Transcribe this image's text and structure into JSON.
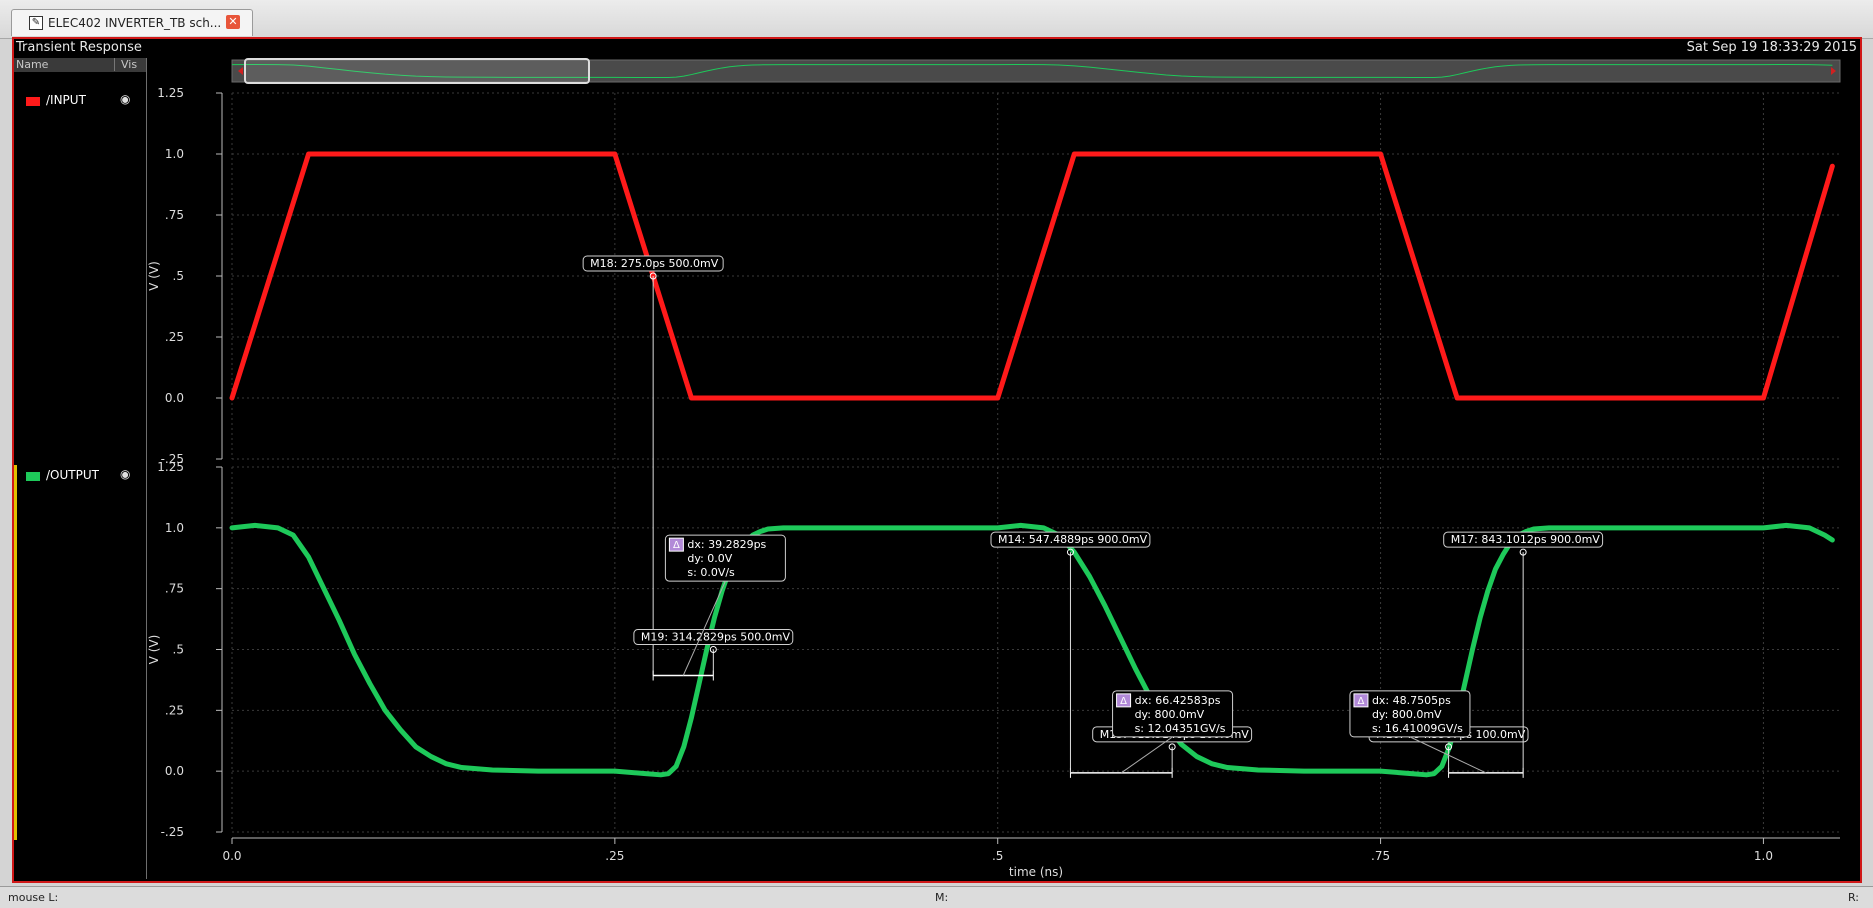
{
  "tab": {
    "title": "ELEC402 INVERTER_TB sch..."
  },
  "window": {
    "title": "Transient Response",
    "timestamp": "Sat Sep 19 18:33:29 2015"
  },
  "panel": {
    "name_header": "Name",
    "vis_header": "Vis"
  },
  "signals": [
    {
      "name": "/INPUT",
      "color": "#ff1a1a"
    },
    {
      "name": "/OUTPUT",
      "color": "#1ec95a"
    }
  ],
  "status": {
    "left": "mouse L:",
    "middle": "M:",
    "right": "R:"
  },
  "chart_data": {
    "type": "line",
    "xlabel": "time (ns)",
    "xlim": [
      0,
      1.05
    ],
    "x_ticks": [
      "0.0",
      ".25",
      ".5",
      ".75",
      "1.0"
    ],
    "x_tick_values": [
      0,
      0.25,
      0.5,
      0.75,
      1.0
    ],
    "panels": [
      {
        "signal": "/INPUT",
        "ylabel": "V (V)",
        "ylim": [
          -0.25,
          1.25
        ],
        "y_ticks": [
          "1.25",
          "1.0",
          ".75",
          ".5",
          ".25",
          "0.0",
          "-.25"
        ],
        "y_tick_values": [
          1.25,
          1.0,
          0.75,
          0.5,
          0.25,
          0.0,
          -0.25
        ],
        "series": [
          {
            "name": "/INPUT",
            "color": "#ff1a1a",
            "x": [
              0,
              0.05,
              0.25,
              0.3,
              0.5,
              0.55,
              0.75,
              0.8,
              1.0,
              1.045
            ],
            "y": [
              0,
              1.0,
              1.0,
              0.0,
              0.0,
              1.0,
              1.0,
              0.0,
              0.0,
              0.95
            ]
          }
        ],
        "markers": [
          {
            "label": "M18: 275.0ps 500.0mV",
            "x": 0.275,
            "y": 0.5
          }
        ]
      },
      {
        "signal": "/OUTPUT",
        "ylabel": "V (V)",
        "ylim": [
          -0.25,
          1.25
        ],
        "y_ticks": [
          "1.25",
          "1.0",
          ".75",
          ".5",
          ".25",
          "0.0",
          "-.25"
        ],
        "y_tick_values": [
          1.25,
          1.0,
          0.75,
          0.5,
          0.25,
          0.0,
          -0.25
        ],
        "series": [
          {
            "name": "/OUTPUT",
            "color": "#1ec95a",
            "x": [
              0,
              0.015,
              0.03,
              0.04,
              0.05,
              0.06,
              0.07,
              0.08,
              0.09,
              0.1,
              0.11,
              0.12,
              0.13,
              0.14,
              0.15,
              0.17,
              0.2,
              0.25,
              0.27,
              0.28,
              0.285,
              0.29,
              0.295,
              0.3,
              0.305,
              0.31,
              0.315,
              0.32,
              0.325,
              0.33,
              0.335,
              0.34,
              0.345,
              0.35,
              0.36,
              0.38,
              0.4,
              0.5,
              0.515,
              0.53,
              0.54,
              0.55,
              0.56,
              0.57,
              0.58,
              0.59,
              0.6,
              0.61,
              0.62,
              0.63,
              0.64,
              0.65,
              0.67,
              0.7,
              0.75,
              0.77,
              0.78,
              0.785,
              0.79,
              0.795,
              0.8,
              0.805,
              0.81,
              0.815,
              0.82,
              0.825,
              0.83,
              0.835,
              0.84,
              0.845,
              0.85,
              0.86,
              0.88,
              0.9,
              1.0,
              1.015,
              1.03,
              1.04,
              1.045
            ],
            "y": [
              1.0,
              1.01,
              1.0,
              0.97,
              0.88,
              0.75,
              0.62,
              0.48,
              0.36,
              0.25,
              0.17,
              0.1,
              0.06,
              0.03,
              0.015,
              0.005,
              0.0,
              0.0,
              -0.01,
              -0.015,
              -0.01,
              0.02,
              0.1,
              0.22,
              0.36,
              0.5,
              0.63,
              0.74,
              0.83,
              0.89,
              0.94,
              0.97,
              0.985,
              0.995,
              1.0,
              1.0,
              1.0,
              1.0,
              1.01,
              1.0,
              0.97,
              0.9,
              0.8,
              0.68,
              0.55,
              0.42,
              0.3,
              0.19,
              0.11,
              0.06,
              0.03,
              0.015,
              0.005,
              0.0,
              0.0,
              -0.01,
              -0.015,
              -0.01,
              0.02,
              0.1,
              0.22,
              0.36,
              0.5,
              0.63,
              0.74,
              0.83,
              0.89,
              0.94,
              0.97,
              0.985,
              0.995,
              1.0,
              1.0,
              1.0,
              1.0,
              1.01,
              1.0,
              0.97,
              0.95
            ]
          }
        ],
        "markers": [
          {
            "label": "M19: 314.2829ps 500.0mV",
            "x": 0.3143,
            "y": 0.5
          },
          {
            "label": "M14: 547.4889ps 900.0mV",
            "x": 0.5475,
            "y": 0.9
          },
          {
            "label": "M15: 613.9148ps 100.0mV",
            "x": 0.6139,
            "y": 0.1
          },
          {
            "label": "M16: 794.3507ps 100.0mV",
            "x": 0.7944,
            "y": 0.1
          },
          {
            "label": "M17: 843.1012ps 900.0mV",
            "x": 0.8431,
            "y": 0.9
          }
        ],
        "deltas": [
          {
            "lines": [
              "dx: 39.2829ps",
              "dy: 0.0V",
              "s: 0.0V/s"
            ],
            "x1": 0.275,
            "x2": 0.3143,
            "at_y": 0.5
          },
          {
            "lines": [
              "dx: 66.42583ps",
              "dy: 800.0mV",
              "s: 12.04351GV/s"
            ],
            "x1": 0.5475,
            "x2": 0.6139,
            "at_y": 0.1
          },
          {
            "lines": [
              "dx: 48.7505ps",
              "dy: 800.0mV",
              "s: 16.41009GV/s"
            ],
            "x1": 0.7944,
            "x2": 0.8431,
            "at_y": 0.1
          }
        ]
      }
    ]
  }
}
